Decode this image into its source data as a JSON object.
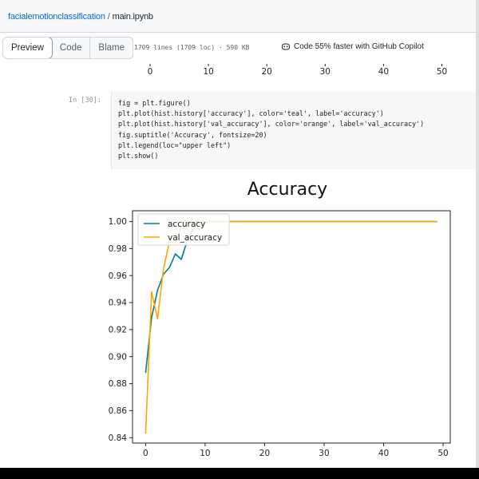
{
  "header": {
    "repo": "facialemotionclassification",
    "separator": "/",
    "file": "main.ipynb"
  },
  "toolbar": {
    "tabs": [
      "Preview",
      "Code",
      "Blame"
    ],
    "active_tab": "Preview",
    "file_info": "1709 lines (1709 loc) · 590 KB",
    "copilot_text": "Code 55% faster with GitHub Copilot",
    "copilot_icon": "copilot-icon"
  },
  "upper_axis": {
    "ticks": [
      "0",
      "10",
      "20",
      "30",
      "40",
      "50"
    ]
  },
  "cell": {
    "prompt": "In [30]:",
    "code": [
      "fig = plt.figure()",
      "plt.plot(hist.history['accuracy'], color='teal', label='accuracy')",
      "plt.plot(hist.history['val_accuracy'], color='orange', label='val_accuracy')",
      "fig.suptitle('Accuracy', fontsize=20)",
      "plt.legend(loc=\"upper left\")",
      "plt.show()"
    ]
  },
  "chart_data": {
    "type": "line",
    "title": "Accuracy",
    "xlabel": "",
    "ylabel": "",
    "xlim": [
      -2.2,
      51.2
    ],
    "ylim": [
      0.836,
      1.008
    ],
    "xticks": [
      0,
      10,
      20,
      30,
      40,
      50
    ],
    "yticks": [
      0.84,
      0.86,
      0.88,
      0.9,
      0.92,
      0.94,
      0.96,
      0.98,
      1.0
    ],
    "grid": false,
    "legend_position": "upper-left",
    "series": [
      {
        "name": "accuracy",
        "color": "#008080",
        "x": [
          0,
          1,
          2,
          3,
          4,
          5,
          6,
          7,
          8,
          9,
          10,
          11,
          12,
          13,
          14,
          15,
          16,
          17,
          18,
          19,
          20,
          21,
          22,
          23,
          24,
          25,
          26,
          27,
          28,
          29,
          30,
          31,
          32,
          33,
          34,
          35,
          36,
          37,
          38,
          39,
          40,
          41,
          42,
          43,
          44,
          45,
          46,
          47,
          48,
          49
        ],
        "y": [
          0.888,
          0.929,
          0.949,
          0.961,
          0.966,
          0.976,
          0.972,
          0.986,
          0.995,
          1.0,
          1.0,
          1.0,
          1.0,
          1.0,
          1.0,
          1.0,
          1.0,
          1.0,
          1.0,
          1.0,
          1.0,
          1.0,
          1.0,
          1.0,
          1.0,
          1.0,
          1.0,
          1.0,
          1.0,
          1.0,
          1.0,
          1.0,
          1.0,
          1.0,
          1.0,
          1.0,
          1.0,
          1.0,
          1.0,
          1.0,
          1.0,
          1.0,
          1.0,
          1.0,
          1.0,
          1.0,
          1.0,
          1.0,
          1.0,
          1.0
        ]
      },
      {
        "name": "val_accuracy",
        "color": "#FFA500",
        "x": [
          0,
          1,
          2,
          3,
          4,
          5,
          6,
          7,
          8,
          9,
          10,
          11,
          12,
          13,
          14,
          15,
          16,
          17,
          18,
          19,
          20,
          21,
          22,
          23,
          24,
          25,
          26,
          27,
          28,
          29,
          30,
          31,
          32,
          33,
          34,
          35,
          36,
          37,
          38,
          39,
          40,
          41,
          42,
          43,
          44,
          45,
          46,
          47,
          48,
          49
        ],
        "y": [
          0.843,
          0.948,
          0.928,
          0.965,
          0.985,
          0.984,
          0.996,
          0.998,
          1.0,
          1.0,
          1.0,
          1.0,
          1.0,
          1.0,
          1.0,
          1.0,
          1.0,
          1.0,
          1.0,
          1.0,
          1.0,
          1.0,
          1.0,
          1.0,
          1.0,
          1.0,
          1.0,
          1.0,
          1.0,
          1.0,
          1.0,
          1.0,
          1.0,
          1.0,
          1.0,
          1.0,
          1.0,
          1.0,
          1.0,
          1.0,
          1.0,
          1.0,
          1.0,
          1.0,
          1.0,
          1.0,
          1.0,
          1.0,
          1.0,
          1.0
        ]
      }
    ]
  }
}
